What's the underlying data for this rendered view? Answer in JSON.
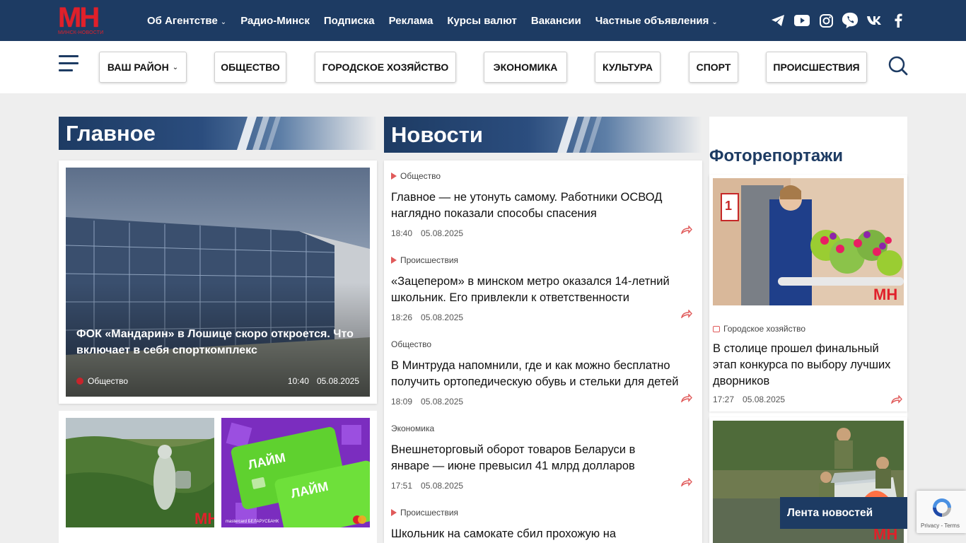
{
  "logo": {
    "text": "МН",
    "sub": "МИНСК-НОВОСТИ"
  },
  "topnav": [
    {
      "label": "Об Агентстве",
      "has_dropdown": true
    },
    {
      "label": "Радио-Минск",
      "has_dropdown": false
    },
    {
      "label": "Подписка",
      "has_dropdown": false
    },
    {
      "label": "Реклама",
      "has_dropdown": false
    },
    {
      "label": "Курсы валют",
      "has_dropdown": false
    },
    {
      "label": "Вакансии",
      "has_dropdown": false
    },
    {
      "label": "Частные объявления",
      "has_dropdown": true
    }
  ],
  "socials": [
    "telegram-icon",
    "youtube-icon",
    "instagram-icon",
    "viber-icon",
    "vk-icon",
    "facebook-icon"
  ],
  "categories": [
    {
      "label": "ВАШ РАЙОН",
      "has_dropdown": true
    },
    {
      "label": "ОБЩЕСТВО"
    },
    {
      "label": "ГОРОДСКОЕ ХОЗЯЙСТВО"
    },
    {
      "label": "ЭКОНОМИКА"
    },
    {
      "label": "КУЛЬТУРА"
    },
    {
      "label": "СПОРТ"
    },
    {
      "label": "ПРОИСШЕСТВИЯ"
    }
  ],
  "glavnoe": {
    "heading": "Главное",
    "main": {
      "title": "ФОК «Мандарин» в Лошице скоро откроется. Что включает в себя спорткомплекс",
      "category": "Общество",
      "time": "10:40",
      "date": "05.08.2025"
    }
  },
  "news": {
    "heading": "Новости",
    "items": [
      {
        "category": "Общество",
        "marker": true,
        "title": "Главное — не утонуть самому. Работники ОСВОД наглядно показали способы спасения",
        "time": "18:40",
        "date": "05.08.2025"
      },
      {
        "category": "Происшествия",
        "marker": true,
        "title": "«Зацепером» в минском метро оказался 14-летний школьник. Его привлекли к ответственности",
        "time": "18:26",
        "date": "05.08.2025"
      },
      {
        "category": "Общество",
        "marker": false,
        "title": "В Минтруда напомнили, где и как можно бесплатно получить ортопедическую обувь и стельки для детей",
        "time": "18:09",
        "date": "05.08.2025"
      },
      {
        "category": "Экономика",
        "marker": false,
        "title": "Внешнеторговый оборот товаров Беларуси в январе — июне превысил 41 млрд долларов",
        "time": "17:51",
        "date": "05.08.2025"
      },
      {
        "category": "Происшествия",
        "marker": true,
        "title": "Школьник на самокате сбил прохожую на",
        "time": "",
        "date": ""
      }
    ]
  },
  "photo": {
    "heading": "Фоторепортажи",
    "items": [
      {
        "category": "Городское хозяйство",
        "title": "В столице прошел финальный этап конкурса по выбору лучших дворников",
        "time": "17:27",
        "date": "05.08.2025",
        "badge": "1"
      }
    ]
  },
  "thumbs": {
    "card_brand": "ЛАЙМ",
    "card_footer": "mastercard  БЕЛАРУСБАНК"
  },
  "lenta_button": "Лента новостей",
  "recaptcha": {
    "label": "Privacy - Terms"
  },
  "colors": {
    "navy": "#1d3b63",
    "red": "#e0202a",
    "accent": "#e05a5a"
  }
}
